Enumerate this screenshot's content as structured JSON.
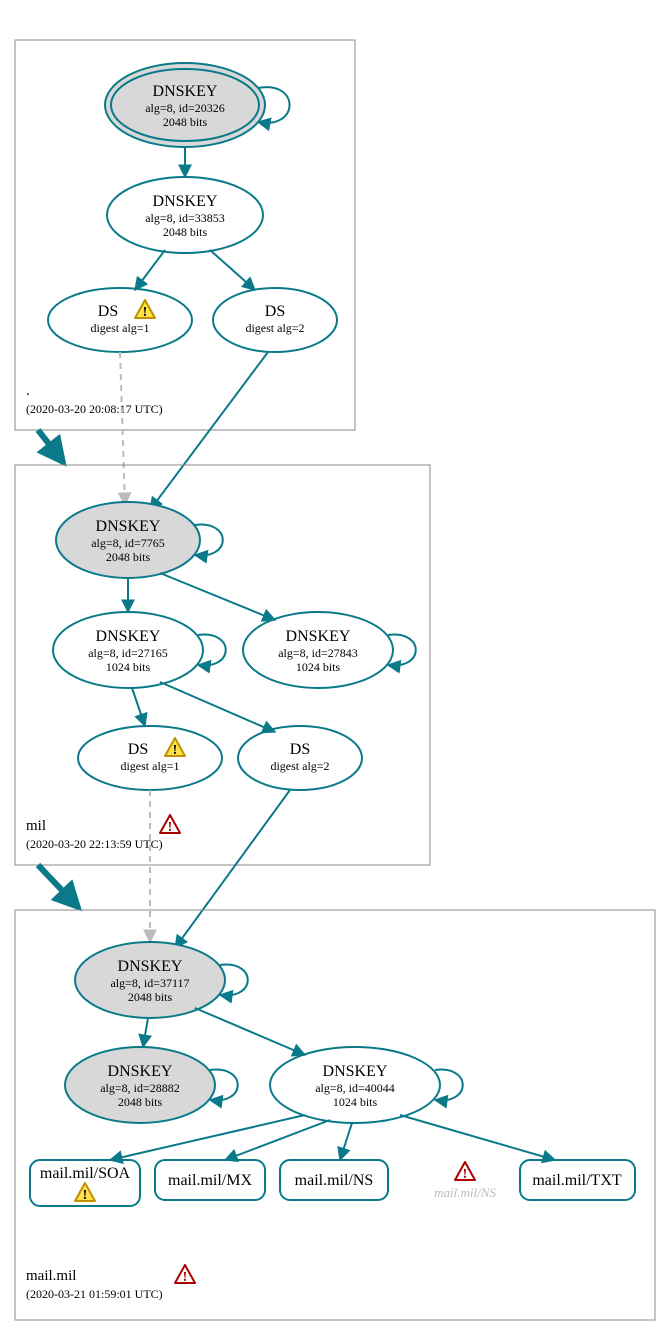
{
  "zones": {
    "root": {
      "label": ".",
      "timestamp": "(2020-03-20 20:08:17 UTC)"
    },
    "mil": {
      "label": "mil",
      "timestamp": "(2020-03-20 22:13:59 UTC)"
    },
    "mailmil": {
      "label": "mail.mil",
      "timestamp": "(2020-03-21 01:59:01 UTC)"
    }
  },
  "nodes": {
    "root_ksk": {
      "title": "DNSKEY",
      "line2": "alg=8, id=20326",
      "line3": "2048 bits"
    },
    "root_zsk": {
      "title": "DNSKEY",
      "line2": "alg=8, id=33853",
      "line3": "2048 bits"
    },
    "root_ds1": {
      "title": "DS",
      "line2": "digest alg=1"
    },
    "root_ds2": {
      "title": "DS",
      "line2": "digest alg=2"
    },
    "mil_ksk": {
      "title": "DNSKEY",
      "line2": "alg=8, id=7765",
      "line3": "2048 bits"
    },
    "mil_zsk1": {
      "title": "DNSKEY",
      "line2": "alg=8, id=27165",
      "line3": "1024 bits"
    },
    "mil_zsk2": {
      "title": "DNSKEY",
      "line2": "alg=8, id=27843",
      "line3": "1024 bits"
    },
    "mil_ds1": {
      "title": "DS",
      "line2": "digest alg=1"
    },
    "mil_ds2": {
      "title": "DS",
      "line2": "digest alg=2"
    },
    "mm_ksk": {
      "title": "DNSKEY",
      "line2": "alg=8, id=37117",
      "line3": "2048 bits"
    },
    "mm_zsk1": {
      "title": "DNSKEY",
      "line2": "alg=8, id=28882",
      "line3": "2048 bits"
    },
    "mm_zsk2": {
      "title": "DNSKEY",
      "line2": "alg=8, id=40044",
      "line3": "1024 bits"
    },
    "rr_soa": {
      "label": "mail.mil/SOA"
    },
    "rr_mx": {
      "label": "mail.mil/MX"
    },
    "rr_ns": {
      "label": "mail.mil/NS"
    },
    "rr_ns_ghost": {
      "label": "mail.mil/NS"
    },
    "rr_txt": {
      "label": "mail.mil/TXT"
    }
  }
}
